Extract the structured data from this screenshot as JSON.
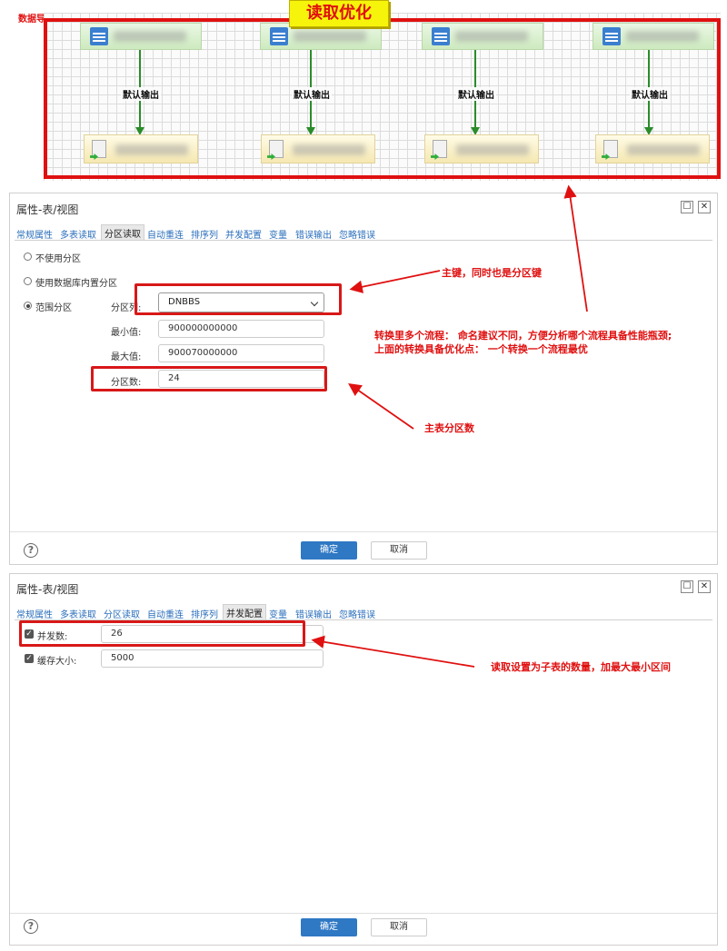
{
  "top": {
    "corner_label": "数据导出为文件",
    "banner": "读取优化",
    "flows": [
      {
        "edge_label": "默认输出"
      },
      {
        "edge_label": "默认输出"
      },
      {
        "edge_label": "默认输出"
      },
      {
        "edge_label": "默认输出"
      }
    ]
  },
  "dialog1": {
    "title": "属性-表/视图",
    "tabs": [
      "常规属性",
      "多表读取",
      "分区读取",
      "自动重连",
      "排序列",
      "并发配置",
      "变量",
      "错误输出",
      "忽略错误"
    ],
    "active_tab": "分区读取",
    "options": {
      "no_partition": "不使用分区",
      "db_partition": "使用数据库内置分区",
      "range_partition": "范围分区"
    },
    "fields": {
      "partition_col_label": "分区列:",
      "partition_col_value": "DNBBS",
      "min_label": "最小值:",
      "min_value": "900000000000",
      "max_label": "最大值:",
      "max_value": "900070000000",
      "count_label": "分区数:",
      "count_value": "24"
    },
    "ok": "确定",
    "cancel": "取消"
  },
  "dialog2": {
    "title": "属性-表/视图",
    "tabs": [
      "常规属性",
      "多表读取",
      "分区读取",
      "自动重连",
      "排序列",
      "并发配置",
      "变量",
      "错误输出",
      "忽略错误"
    ],
    "active_tab": "并发配置",
    "fields": {
      "concurrency_label": "并发数:",
      "concurrency_value": "26",
      "cache_label": "缓存大小:",
      "cache_value": "5000"
    },
    "ok": "确定",
    "cancel": "取消"
  },
  "annotations": {
    "primary_key": "主键，同时也是分区键",
    "multi_flow_1": "转换里多个流程：  命名建议不同，方便分析哪个流程具备性能瓶颈;",
    "multi_flow_2": "上面的转换具备优化点：   一个转换一个流程最优",
    "main_table": "主表分区数",
    "concurrency_note": "读取设置为子表的数量，加最大最小区间"
  },
  "colors": {
    "annotation_red": "#e01010",
    "primary_blue": "#2f78c4",
    "flow_green": "#2a8c2a",
    "banner_yellow": "#f6f40a"
  }
}
